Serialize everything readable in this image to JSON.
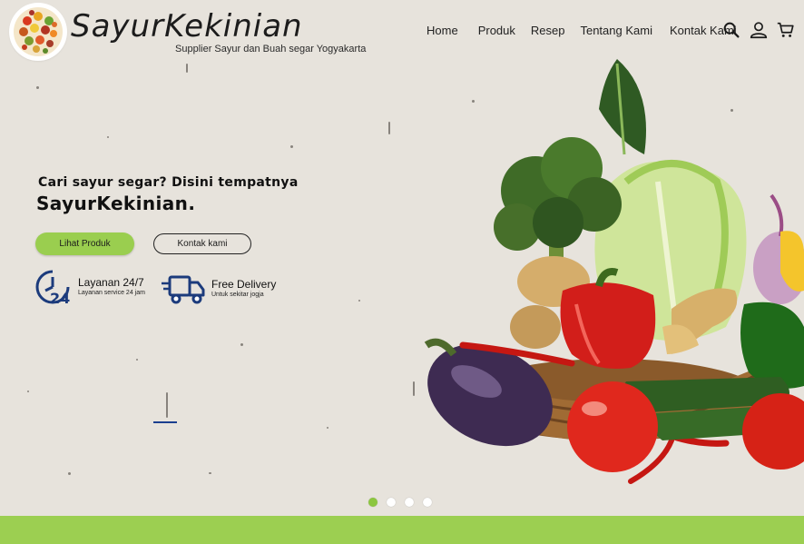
{
  "header": {
    "brand_name": "SayurKekinian",
    "tagline": "Supplier Sayur dan Buah segar Yogyakarta",
    "logo_icon": "vegetable-mosaic-logo"
  },
  "nav": {
    "links": [
      "Home",
      "Produk",
      "Resep",
      "Tentang Kami",
      "Kontak Kami"
    ],
    "icons": [
      "search-icon",
      "user-icon",
      "cart-icon"
    ]
  },
  "hero": {
    "subtitle": "Cari sayur segar? Disini tempatnya",
    "title": "SayurKekinian.",
    "primary_button": "Lihat Produk",
    "secondary_button": "Kontak kami",
    "features": [
      {
        "icon": "clock-24-icon",
        "title": "Layanan 24/7",
        "subtitle": "Layanan service 24 jam"
      },
      {
        "icon": "delivery-truck-icon",
        "title": "Free Delivery",
        "subtitle": "Untuk sekitar jogja"
      }
    ]
  },
  "carousel": {
    "slide_count": 4,
    "active_index": 0
  },
  "colors": {
    "accent": "#9ace4f",
    "background": "#e7e3dc",
    "dark_blue": "#1b3f8f"
  }
}
